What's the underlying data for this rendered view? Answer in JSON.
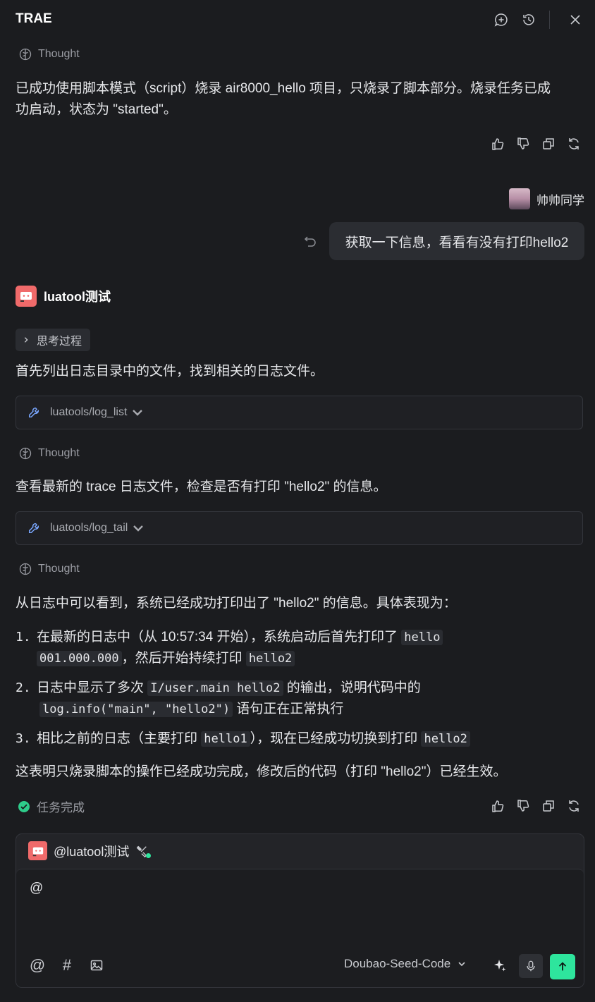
{
  "app": {
    "title": "TRAE"
  },
  "block1": {
    "thought_label": "Thought",
    "text_line1": "已成功使用脚本模式（script）烧录 air8000_hello 项目，只烧录了脚本部分。烧录任务已成",
    "text_line2": "功启动，状态为 \"started\"。"
  },
  "user": {
    "name": "帅帅同学",
    "message": "获取一下信息，看看有没有打印hello2"
  },
  "agent": {
    "name": "luatool测试",
    "think_toggle": "思考过程",
    "intro": "首先列出日志目录中的文件，找到相关的日志文件。",
    "tool1": "luatools/log_list",
    "thought2": "Thought",
    "text2": "查看最新的 trace 日志文件，检查是否有打印 \"hello2\" 的信息。",
    "tool2": "luatools/log_tail",
    "thought3": "Thought",
    "text3": "从日志中可以看到，系统已经成功打印出了 \"hello2\" 的信息。具体表现为：",
    "items": [
      {
        "num": "1.",
        "a": "在最新的日志中（从 10:57:34 开始），系统启动后首先打印了 ",
        "code1": "hello",
        "code1b": "001.000.000",
        "b": "，然后开始持续打印 ",
        "code2": "hello2"
      },
      {
        "num": "2.",
        "a": "日志中显示了多次 ",
        "code1": "I/user.main hello2",
        "b": " 的输出，说明代码中的",
        "code2": "log.info(\"main\", \"hello2\")",
        "c": " 语句正在正常执行"
      },
      {
        "num": "3.",
        "a": "相比之前的日志（主要打印 ",
        "code1": "hello1",
        "b": "），现在已经成功切换到打印 ",
        "code2": "hello2"
      }
    ],
    "conclusion": "这表明只烧录脚本的操作已经成功完成，修改后的代码（打印 \"hello2\"）已经生效。",
    "status": "任务完成"
  },
  "composer": {
    "agent_tag": "@luatool测试",
    "input_value": "@",
    "model": "Doubao-Seed-Code"
  },
  "colors": {
    "accent": "#2ee59d",
    "avatar_bg": "#f06a6a",
    "background": "#1b1c1f"
  }
}
